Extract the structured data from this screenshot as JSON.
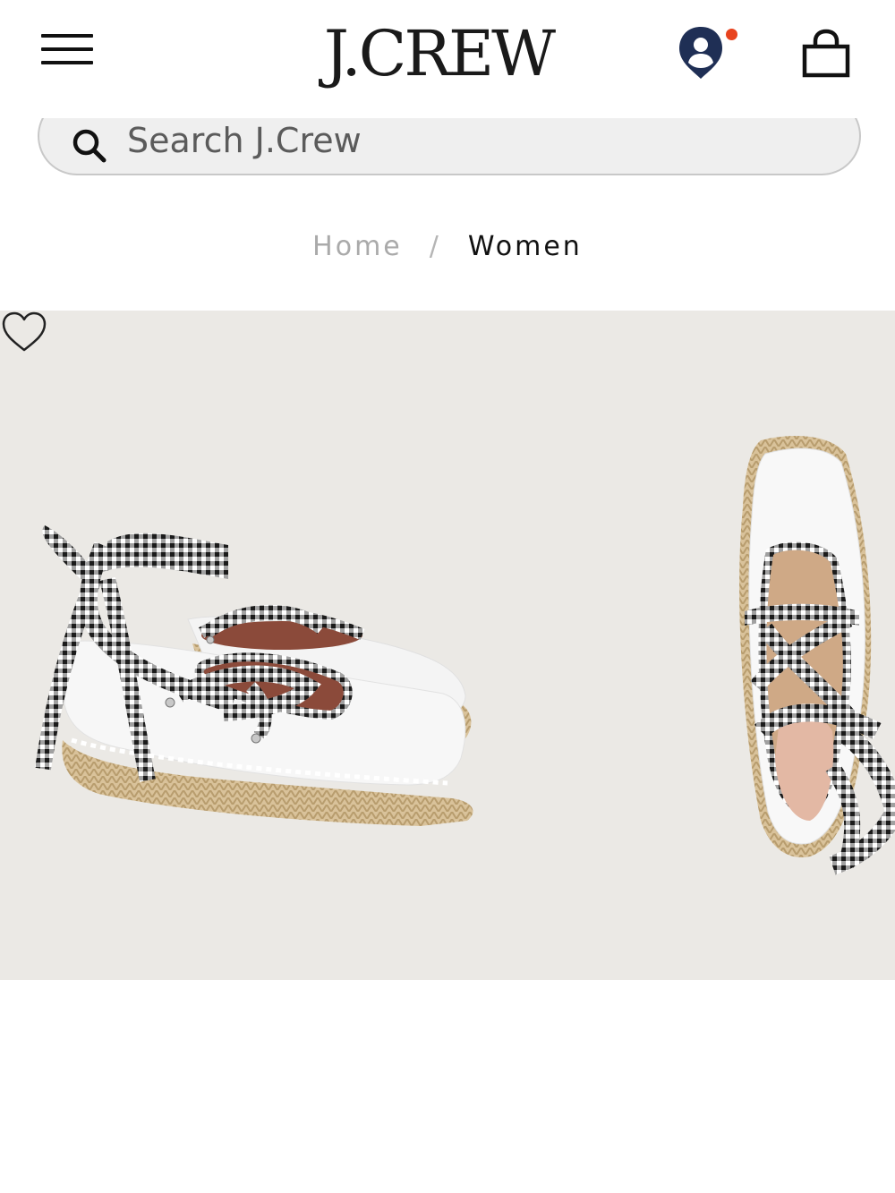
{
  "header": {
    "logo_text": "J.CREW",
    "menu_icon": "hamburger-menu-icon",
    "account_icon": "user-location-icon",
    "bag_icon": "shopping-bag-icon",
    "notification_color": "#e8431e",
    "account_color": "#1f2f55"
  },
  "search": {
    "placeholder": "Search J.Crew",
    "value": ""
  },
  "breadcrumb": {
    "items": [
      "Home",
      "Women"
    ],
    "separator": "/"
  },
  "product": {
    "background": "#ebe9e5",
    "wishlist_icon": "heart-outline-icon"
  }
}
